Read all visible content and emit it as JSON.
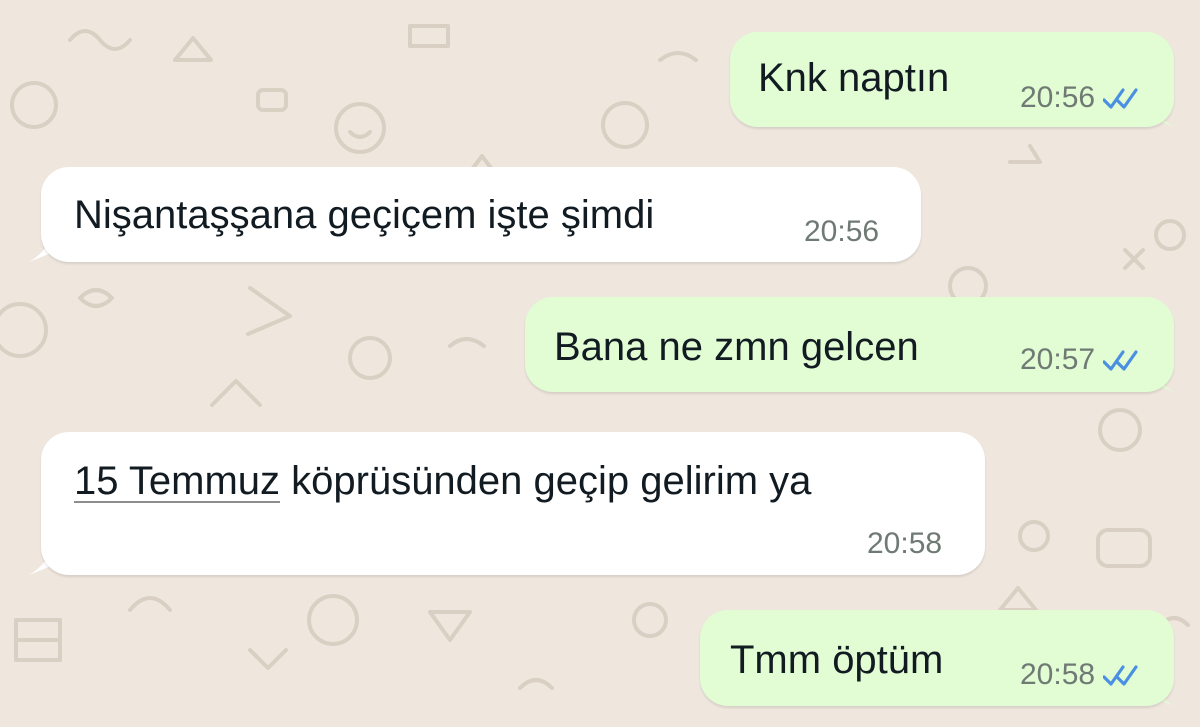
{
  "colors": {
    "wallpaper": "#efe7de",
    "doodle": "#d9cfc2",
    "outgoing_bubble": "#e2fcd4",
    "incoming_bubble": "#ffffff",
    "text": "#111b21",
    "time": "#6f7a74",
    "read_receipt": "#4a90e2"
  },
  "messages": [
    {
      "direction": "outgoing",
      "text": "Knk naptın",
      "time": "20:56",
      "status_icon": "double-check-read-icon"
    },
    {
      "direction": "incoming",
      "text": "Nişantaşşana geçiçem işte şimdi",
      "time": "20:56"
    },
    {
      "direction": "outgoing",
      "text": "Bana ne zmn gelcen",
      "time": "20:57",
      "status_icon": "double-check-read-icon"
    },
    {
      "direction": "incoming",
      "text_link": "15 Temmuz",
      "text_rest": " köprüsünden geçip gelirim ya",
      "time": "20:58"
    },
    {
      "direction": "outgoing",
      "text": "Tmm öptüm",
      "time": "20:58",
      "status_icon": "double-check-read-icon"
    }
  ]
}
